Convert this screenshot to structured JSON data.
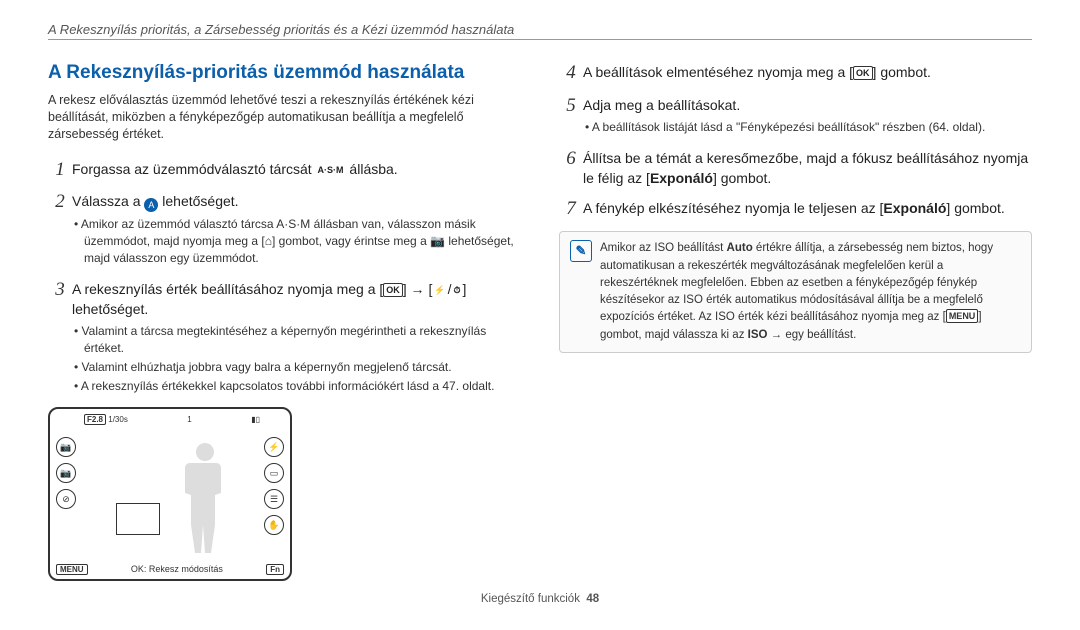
{
  "header": "A Rekesznyílás prioritás, a Zársebesség prioritás és a Kézi üzemmód használata",
  "title": "A Rekesznyílás-prioritás üzemmód használata",
  "intro": "A rekesz előválasztás üzemmód lehetővé teszi a rekesznyílás értékének kézi beállítását, miközben a fényképezőgép automatikusan beállítja a megfelelő zársebesség értéket.",
  "glyphs": {
    "asm": "A·S·M",
    "ok": "OK",
    "menu": "MENU",
    "flash": "⚡",
    "timer": "⏱",
    "home": "⌂",
    "camera": "📷",
    "fn": "Fn"
  },
  "left_steps": [
    {
      "n": "1",
      "pre": "Forgassa az üzemmódválasztó tárcsát ",
      "glyph": "asm",
      "post": " állásba."
    },
    {
      "n": "2",
      "pre": "Válassza a ",
      "icon": "A",
      "post": " lehetőséget.",
      "sub": [
        "Amikor az üzemmód választó tárcsa A·S·M állásban van, válasszon másik üzemmódot, majd nyomja meg a [⌂] gombot, vagy érintse meg a 📷 lehetőséget, majd válasszon egy üzemmódot."
      ]
    },
    {
      "n": "3",
      "text": "A rekesznyílás érték beállításához nyomja meg a [OK] → [⚡/⏱] lehetőséget.",
      "sub": [
        "Valamint a tárcsa megtekintéséhez a képernyőn megérintheti a rekesznyílás értéket.",
        "Valamint elhúzhatja jobbra vagy balra a képernyőn megjelenő tárcsát.",
        "A rekesznyílás értékekkel kapcsolatos további információkért lásd a 47. oldalt."
      ]
    }
  ],
  "right_steps": [
    {
      "n": "4",
      "text": "A beállítások elmentéséhez nyomja meg a [OK] gombot."
    },
    {
      "n": "5",
      "text": "Adja meg a beállításokat.",
      "sub": [
        "A beállítások listáját lásd a \"Fényképezési beállítások\" részben (64. oldal)."
      ]
    },
    {
      "n": "6",
      "html": "Állítsa be a témát a keresőmezőbe, majd a fókusz beállításához nyomja le félig az [<b>Exponáló</b>] gombot."
    },
    {
      "n": "7",
      "html": "A fénykép elkészítéséhez nyomja le teljesen az [<b>Exponáló</b>] gombot."
    }
  ],
  "note": "Amikor az ISO beállítást <b>Auto</b> értékre állítja, a zársebesség nem biztos, hogy automatikusan a rekeszérték megváltozásának megfelelően kerül a rekeszértéknek megfelelően. Ebben az esetben a fényképezőgép fénykép készítésekor az ISO érték automatikus módosításával állítja be a megfelelő expozíciós értéket. Az ISO érték kézi beállításához nyomja meg az [<span class='glyph'>MENU</span>] gombot, majd válassza ki az <b>ISO</b> → egy beállítást.",
  "cam": {
    "f": "F2.8",
    "s": "1/30s",
    "count": "1",
    "bottom": "OK: Rekesz módosítás"
  },
  "footer": {
    "label": "Kiegészítő funkciók",
    "page": "48"
  }
}
